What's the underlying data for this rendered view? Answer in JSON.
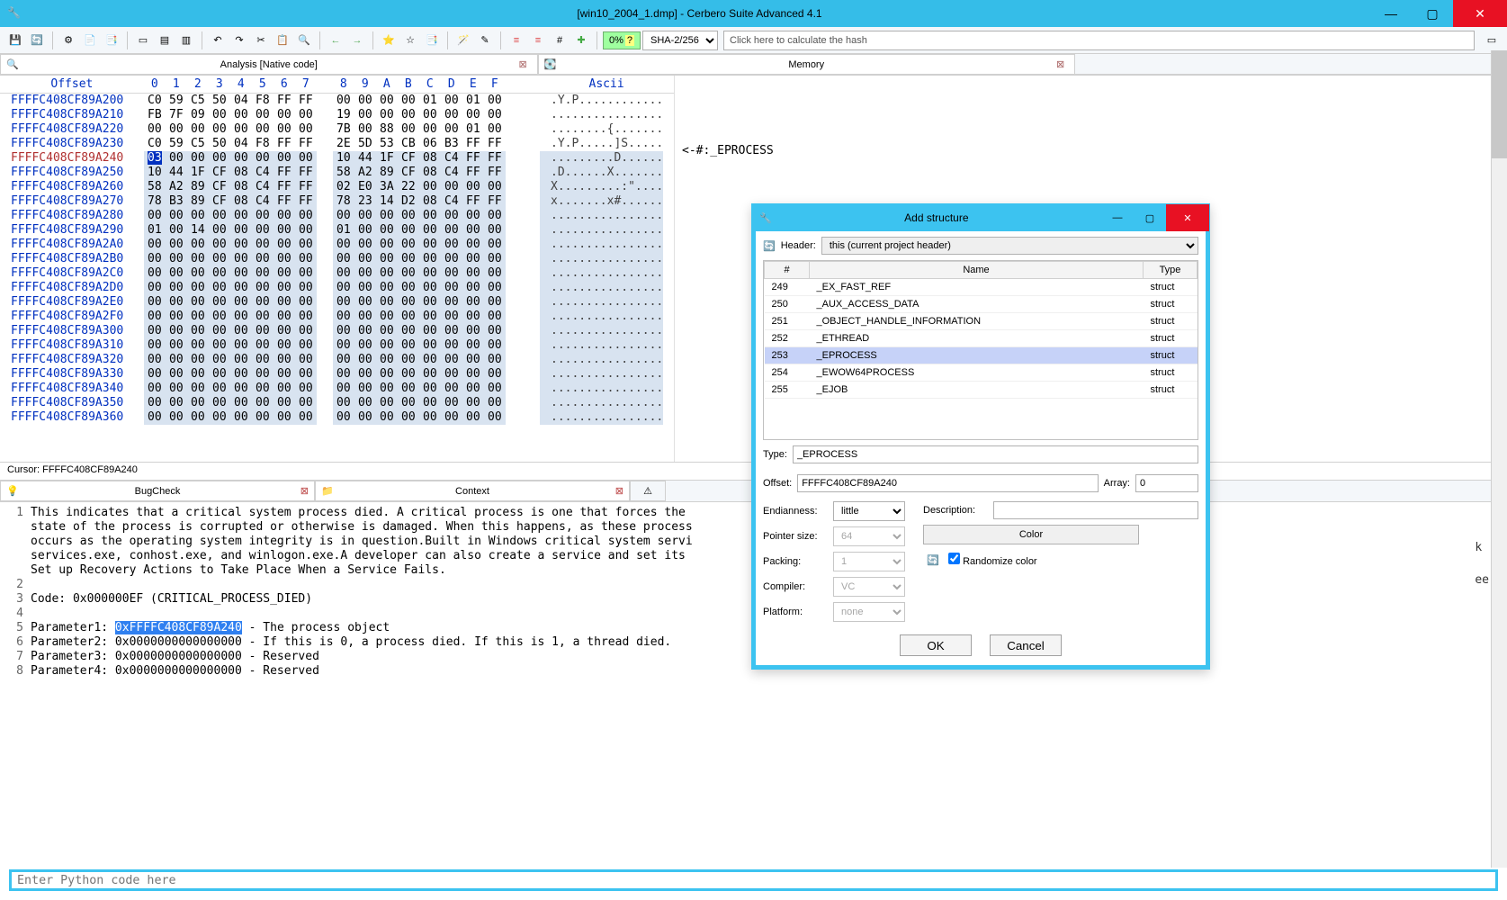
{
  "title": "[win10_2004_1.dmp] - Cerbero Suite Advanced 4.1",
  "percent": "0%",
  "hashcombo": "SHA-2/256",
  "hashfield": "Click here to calculate the hash",
  "tabs": {
    "analysis": "Analysis [Native code]",
    "memory": "Memory"
  },
  "hex": {
    "columns": [
      "0",
      "1",
      "2",
      "3",
      "4",
      "5",
      "6",
      "7",
      "8",
      "9",
      "A",
      "B",
      "C",
      "D",
      "E",
      "F"
    ],
    "off_label": "Offset",
    "asc_label": "Ascii",
    "rows": [
      {
        "o": "FFFFC408CF89A200",
        "b": [
          "C0",
          "59",
          "C5",
          "50",
          "04",
          "F8",
          "FF",
          "FF",
          "00",
          "00",
          "00",
          "00",
          "01",
          "00",
          "01",
          "00"
        ],
        "a": ".Y.P............"
      },
      {
        "o": "FFFFC408CF89A210",
        "b": [
          "FB",
          "7F",
          "09",
          "00",
          "00",
          "00",
          "00",
          "00",
          "19",
          "00",
          "00",
          "00",
          "00",
          "00",
          "00",
          "00"
        ],
        "a": "................"
      },
      {
        "o": "FFFFC408CF89A220",
        "b": [
          "00",
          "00",
          "00",
          "00",
          "00",
          "00",
          "00",
          "00",
          "7B",
          "00",
          "88",
          "00",
          "00",
          "00",
          "01",
          "00"
        ],
        "a": "........{......."
      },
      {
        "o": "FFFFC408CF89A230",
        "b": [
          "C0",
          "59",
          "C5",
          "50",
          "04",
          "F8",
          "FF",
          "FF",
          "2E",
          "5D",
          "53",
          "CB",
          "06",
          "B3",
          "FF",
          "FF"
        ],
        "a": ".Y.P.....]S....."
      },
      {
        "o": "FFFFC408CF89A240",
        "b": [
          "03",
          "00",
          "00",
          "00",
          "00",
          "00",
          "00",
          "00",
          "10",
          "44",
          "1F",
          "CF",
          "08",
          "C4",
          "FF",
          "FF"
        ],
        "a": ".........D......",
        "sel": true,
        "hl": 0
      },
      {
        "o": "FFFFC408CF89A250",
        "b": [
          "10",
          "44",
          "1F",
          "CF",
          "08",
          "C4",
          "FF",
          "FF",
          "58",
          "A2",
          "89",
          "CF",
          "08",
          "C4",
          "FF",
          "FF"
        ],
        "a": ".D......X.......",
        "sel": true
      },
      {
        "o": "FFFFC408CF89A260",
        "b": [
          "58",
          "A2",
          "89",
          "CF",
          "08",
          "C4",
          "FF",
          "FF",
          "02",
          "E0",
          "3A",
          "22",
          "00",
          "00",
          "00",
          "00"
        ],
        "a": "X.........:\"....",
        "sel": true
      },
      {
        "o": "FFFFC408CF89A270",
        "b": [
          "78",
          "B3",
          "89",
          "CF",
          "08",
          "C4",
          "FF",
          "FF",
          "78",
          "23",
          "14",
          "D2",
          "08",
          "C4",
          "FF",
          "FF"
        ],
        "a": "x.......x#......",
        "sel": true
      },
      {
        "o": "FFFFC408CF89A280",
        "b": [
          "00",
          "00",
          "00",
          "00",
          "00",
          "00",
          "00",
          "00",
          "00",
          "00",
          "00",
          "00",
          "00",
          "00",
          "00",
          "00"
        ],
        "a": "................",
        "sel": true
      },
      {
        "o": "FFFFC408CF89A290",
        "b": [
          "01",
          "00",
          "14",
          "00",
          "00",
          "00",
          "00",
          "00",
          "01",
          "00",
          "00",
          "00",
          "00",
          "00",
          "00",
          "00"
        ],
        "a": "................",
        "sel": true
      },
      {
        "o": "FFFFC408CF89A2A0",
        "b": [
          "00",
          "00",
          "00",
          "00",
          "00",
          "00",
          "00",
          "00",
          "00",
          "00",
          "00",
          "00",
          "00",
          "00",
          "00",
          "00"
        ],
        "a": "................",
        "sel": true
      },
      {
        "o": "FFFFC408CF89A2B0",
        "b": [
          "00",
          "00",
          "00",
          "00",
          "00",
          "00",
          "00",
          "00",
          "00",
          "00",
          "00",
          "00",
          "00",
          "00",
          "00",
          "00"
        ],
        "a": "................",
        "sel": true
      },
      {
        "o": "FFFFC408CF89A2C0",
        "b": [
          "00",
          "00",
          "00",
          "00",
          "00",
          "00",
          "00",
          "00",
          "00",
          "00",
          "00",
          "00",
          "00",
          "00",
          "00",
          "00"
        ],
        "a": "................",
        "sel": true
      },
      {
        "o": "FFFFC408CF89A2D0",
        "b": [
          "00",
          "00",
          "00",
          "00",
          "00",
          "00",
          "00",
          "00",
          "00",
          "00",
          "00",
          "00",
          "00",
          "00",
          "00",
          "00"
        ],
        "a": "................",
        "sel": true
      },
      {
        "o": "FFFFC408CF89A2E0",
        "b": [
          "00",
          "00",
          "00",
          "00",
          "00",
          "00",
          "00",
          "00",
          "00",
          "00",
          "00",
          "00",
          "00",
          "00",
          "00",
          "00"
        ],
        "a": "................",
        "sel": true
      },
      {
        "o": "FFFFC408CF89A2F0",
        "b": [
          "00",
          "00",
          "00",
          "00",
          "00",
          "00",
          "00",
          "00",
          "00",
          "00",
          "00",
          "00",
          "00",
          "00",
          "00",
          "00"
        ],
        "a": "................",
        "sel": true
      },
      {
        "o": "FFFFC408CF89A300",
        "b": [
          "00",
          "00",
          "00",
          "00",
          "00",
          "00",
          "00",
          "00",
          "00",
          "00",
          "00",
          "00",
          "00",
          "00",
          "00",
          "00"
        ],
        "a": "................",
        "sel": true
      },
      {
        "o": "FFFFC408CF89A310",
        "b": [
          "00",
          "00",
          "00",
          "00",
          "00",
          "00",
          "00",
          "00",
          "00",
          "00",
          "00",
          "00",
          "00",
          "00",
          "00",
          "00"
        ],
        "a": "................",
        "sel": true
      },
      {
        "o": "FFFFC408CF89A320",
        "b": [
          "00",
          "00",
          "00",
          "00",
          "00",
          "00",
          "00",
          "00",
          "00",
          "00",
          "00",
          "00",
          "00",
          "00",
          "00",
          "00"
        ],
        "a": "................",
        "sel": true
      },
      {
        "o": "FFFFC408CF89A330",
        "b": [
          "00",
          "00",
          "00",
          "00",
          "00",
          "00",
          "00",
          "00",
          "00",
          "00",
          "00",
          "00",
          "00",
          "00",
          "00",
          "00"
        ],
        "a": "................",
        "sel": true
      },
      {
        "o": "FFFFC408CF89A340",
        "b": [
          "00",
          "00",
          "00",
          "00",
          "00",
          "00",
          "00",
          "00",
          "00",
          "00",
          "00",
          "00",
          "00",
          "00",
          "00",
          "00"
        ],
        "a": "................",
        "sel": true
      },
      {
        "o": "FFFFC408CF89A350",
        "b": [
          "00",
          "00",
          "00",
          "00",
          "00",
          "00",
          "00",
          "00",
          "00",
          "00",
          "00",
          "00",
          "00",
          "00",
          "00",
          "00"
        ],
        "a": "................",
        "sel": true
      },
      {
        "o": "FFFFC408CF89A360",
        "b": [
          "00",
          "00",
          "00",
          "00",
          "00",
          "00",
          "00",
          "00",
          "00",
          "00",
          "00",
          "00",
          "00",
          "00",
          "00",
          "00"
        ],
        "a": "................",
        "sel": true
      }
    ],
    "annotation": "<-#:_EPROCESS"
  },
  "cursor": "Cursor: FFFFC408CF89A240",
  "mtabs": {
    "bugcheck": "BugCheck",
    "context": "Context"
  },
  "bugtext": [
    "This indicates that a critical system process died. A critical process is one that forces the",
    "state of the process is corrupted or otherwise is damaged. When this happens, as these process",
    "occurs as the operating system integrity is in question.Built in Windows critical system servi",
    "services.exe, conhost.exe, and winlogon.exe.A developer can also create a service and set its ",
    "Set up Recovery Actions to Take Place When a Service Fails.",
    "",
    "Code: 0x000000EF (CRITICAL_PROCESS_DIED)",
    "",
    "Parameter1: 0xFFFFC408CF89A240 - The process object",
    "Parameter2: 0x0000000000000000 - If this is 0, a process died. If this is 1, a thread died.",
    "Parameter3: 0x0000000000000000 - Reserved",
    "Parameter4: 0x0000000000000000 - Reserved"
  ],
  "sidetext": [
    "k",
    "",
    "ee"
  ],
  "pyplaceholder": "Enter Python code here",
  "dlg": {
    "title": "Add structure",
    "header_label": "Header:",
    "header_value": "this (current project header)",
    "cols": {
      "num": "#",
      "name": "Name",
      "type": "Type"
    },
    "rows": [
      {
        "n": "249",
        "name": "_EX_FAST_REF",
        "t": "struct"
      },
      {
        "n": "250",
        "name": "_AUX_ACCESS_DATA",
        "t": "struct"
      },
      {
        "n": "251",
        "name": "_OBJECT_HANDLE_INFORMATION",
        "t": "struct"
      },
      {
        "n": "252",
        "name": "_ETHREAD",
        "t": "struct"
      },
      {
        "n": "253",
        "name": "_EPROCESS",
        "t": "struct",
        "sel": true
      },
      {
        "n": "254",
        "name": "_EWOW64PROCESS",
        "t": "struct"
      },
      {
        "n": "255",
        "name": "_EJOB",
        "t": "struct"
      }
    ],
    "type_label": "Type:",
    "type_value": "_EPROCESS",
    "offset_label": "Offset:",
    "offset_value": "FFFFC408CF89A240",
    "array_label": "Array:",
    "array_value": "0",
    "endian_label": "Endianness:",
    "endian": "little",
    "ptr_label": "Pointer size:",
    "ptr": "64",
    "pack_label": "Packing:",
    "pack": "1",
    "comp_label": "Compiler:",
    "comp": "VC",
    "plat_label": "Platform:",
    "plat": "none",
    "desc_label": "Description:",
    "color_btn": "Color",
    "rand": "Randomize color",
    "ok": "OK",
    "cancel": "Cancel"
  }
}
